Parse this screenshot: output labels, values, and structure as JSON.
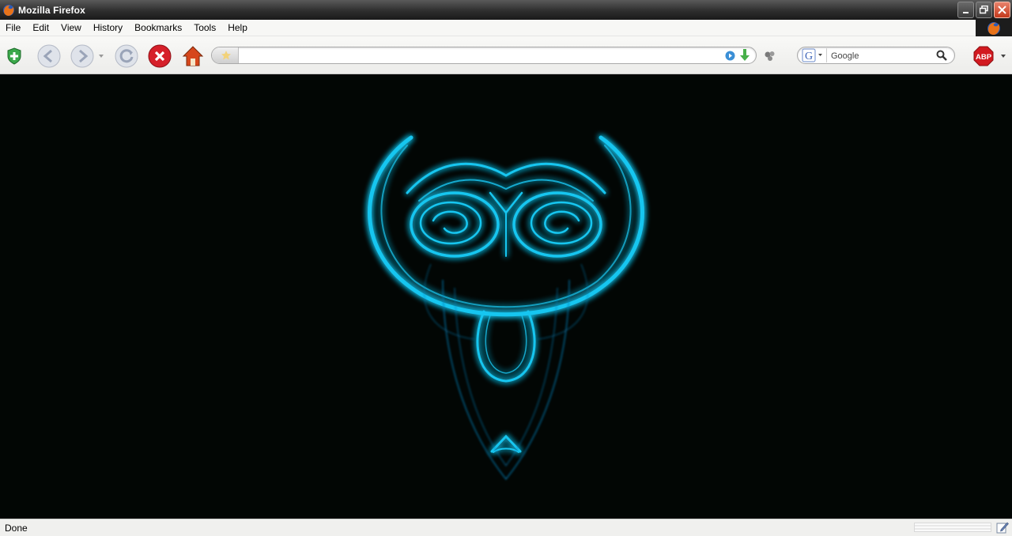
{
  "window": {
    "title": "Mozilla Firefox"
  },
  "menu": {
    "items": [
      {
        "label": "File"
      },
      {
        "label": "Edit"
      },
      {
        "label": "View"
      },
      {
        "label": "History"
      },
      {
        "label": "Bookmarks"
      },
      {
        "label": "Tools"
      },
      {
        "label": "Help"
      }
    ]
  },
  "toolbar": {
    "url_value": "",
    "search_engine": "Google",
    "search_placeholder": "Google",
    "adblock_label": "ABP"
  },
  "status": {
    "text": "Done"
  },
  "colors": {
    "glow": "#19c6f0",
    "content_bg": "#020604"
  },
  "icons": {
    "app": "firefox-icon",
    "shield": "shield-icon",
    "back": "back-arrow-icon",
    "forward": "forward-arrow-icon",
    "reload": "reload-icon",
    "stop": "stop-icon",
    "home": "home-icon",
    "go": "go-arrow-icon",
    "search": "magnifier-icon"
  }
}
